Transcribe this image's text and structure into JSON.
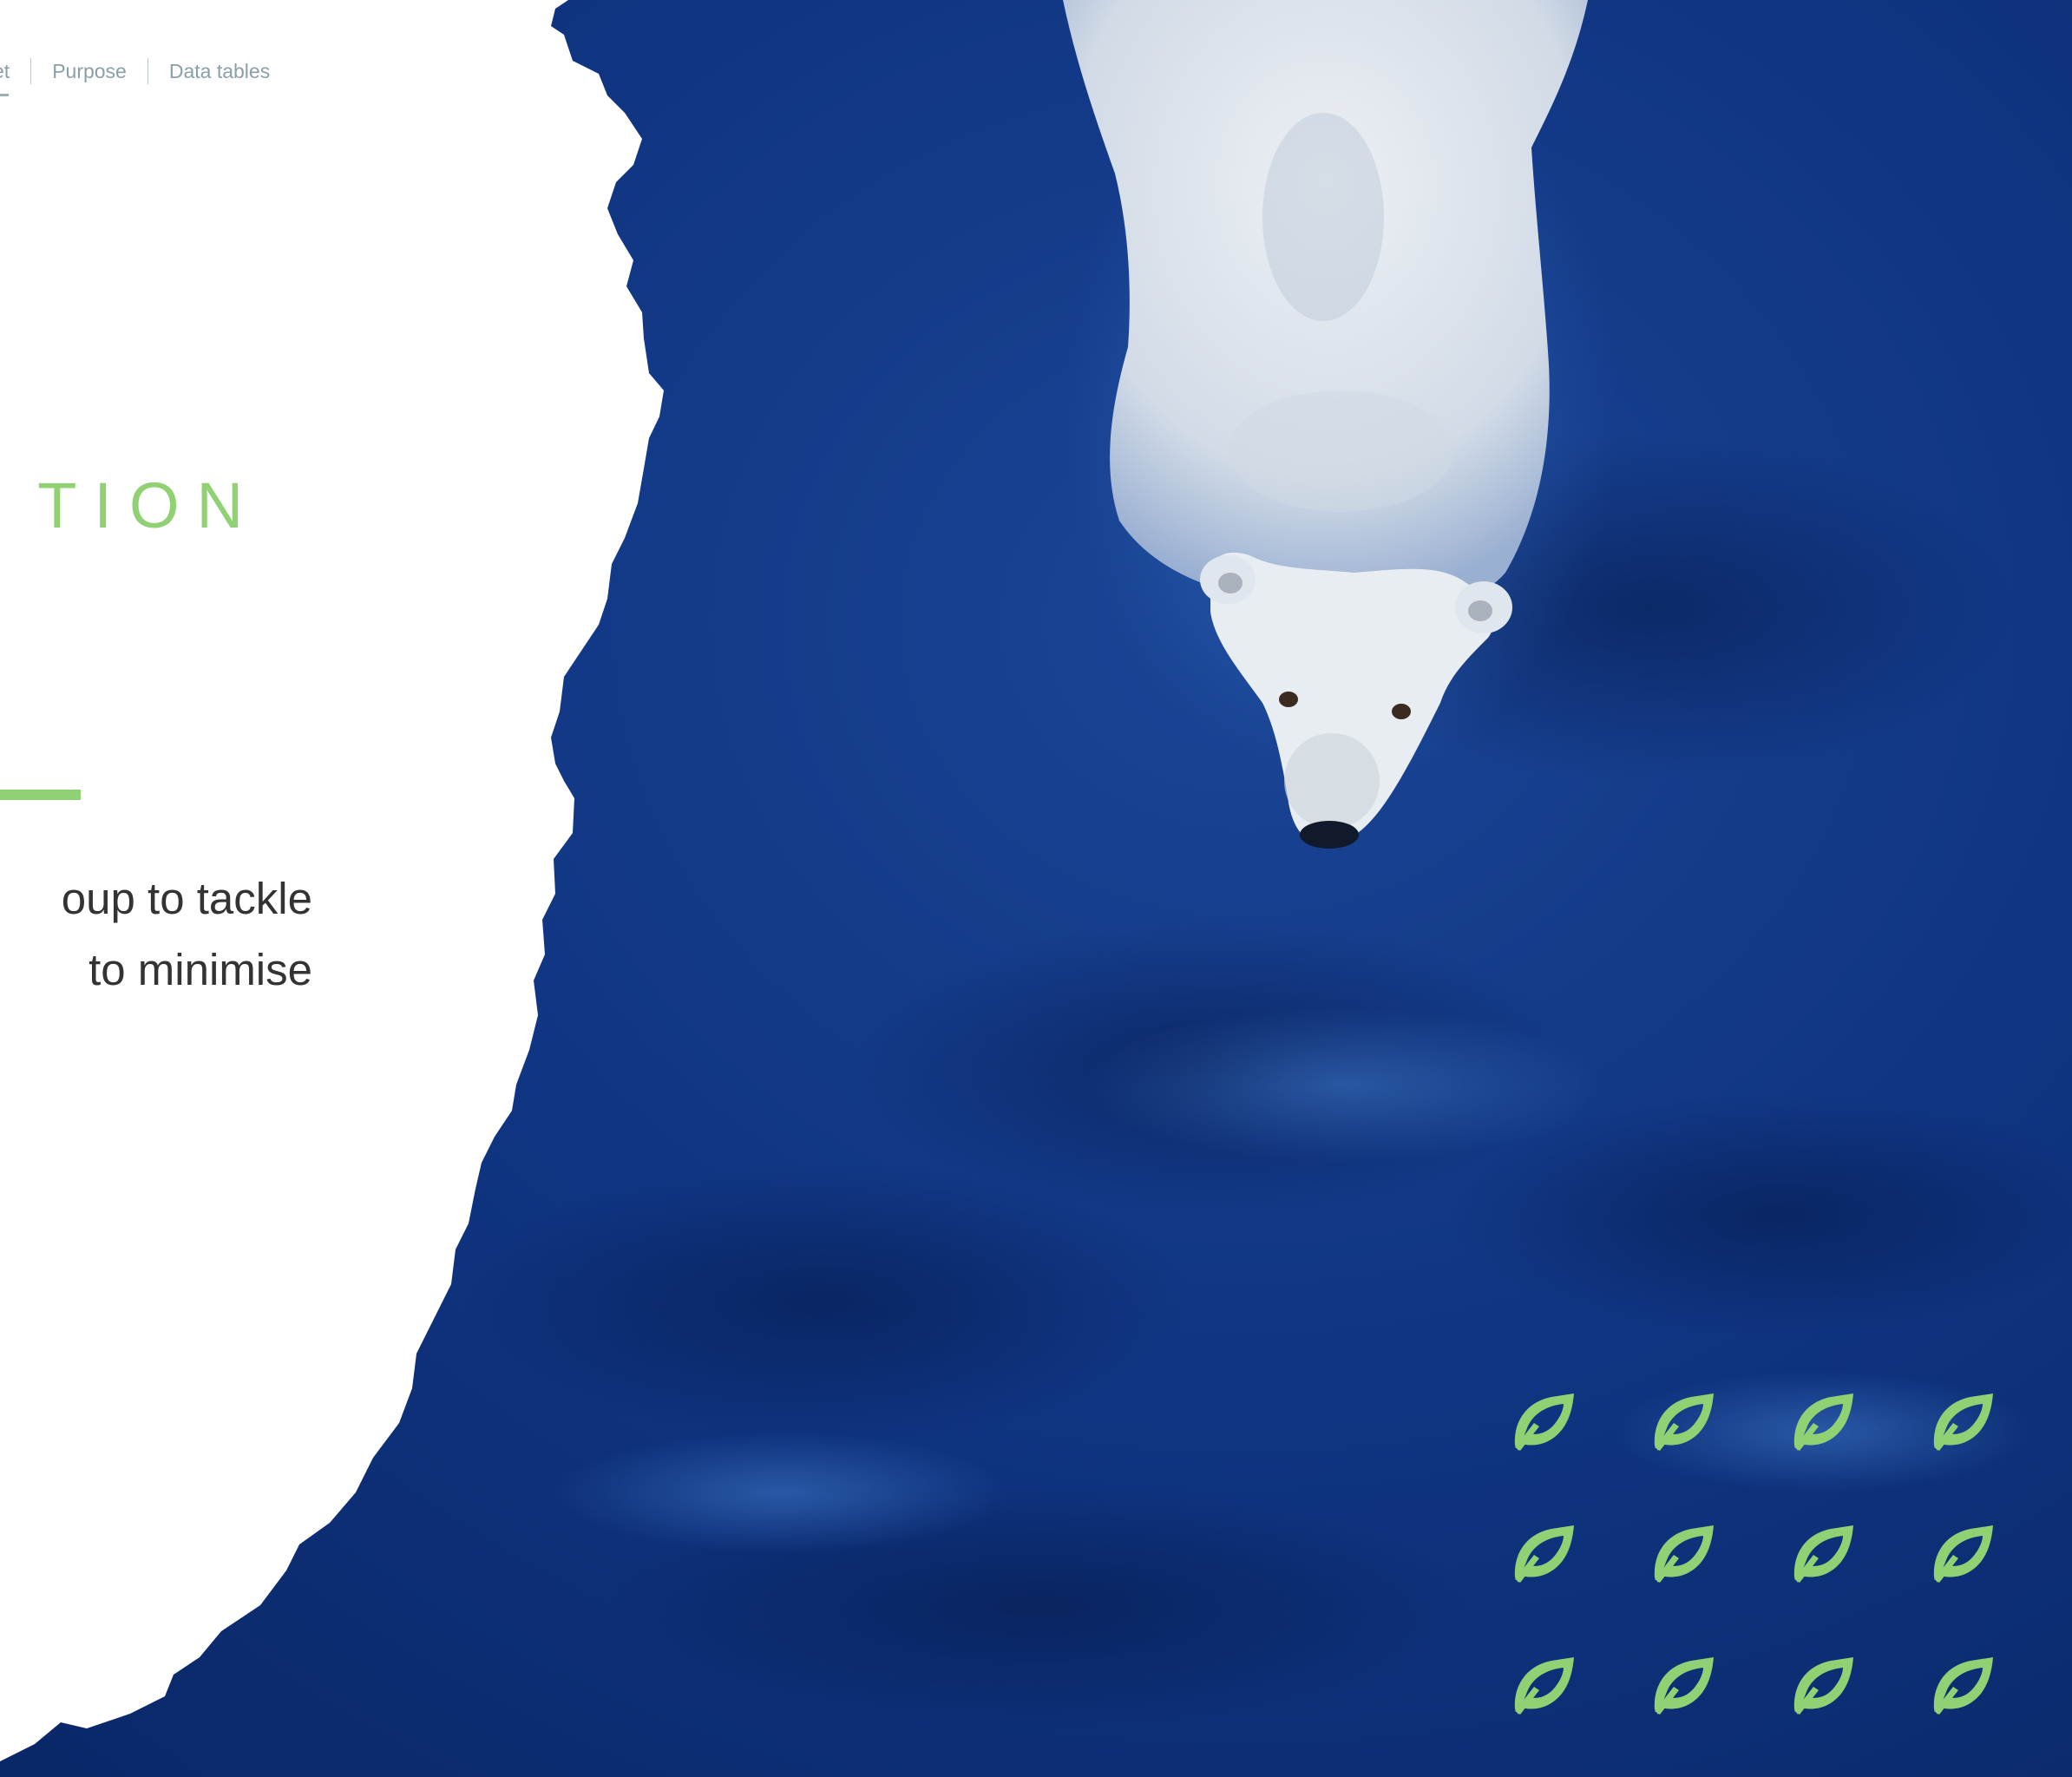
{
  "nav": {
    "items": [
      "et",
      "Purpose",
      "Data tables"
    ]
  },
  "section": {
    "title": "TION"
  },
  "body": {
    "lines": [
      "oup to tackle",
      "to minimise"
    ]
  },
  "photo": {
    "subject": "polar bear swimming in deep blue water"
  },
  "icons": {
    "leaf_icon_name": "leaf-icon",
    "leaf_color": "#8fd173",
    "rows": 3,
    "cols": 4
  },
  "colors": {
    "accent": "#8fd173",
    "ocean_dark": "#0b2a6e",
    "ocean_light": "#1a4b9e",
    "nav_text": "#8aa0a8",
    "body_text": "#333333"
  }
}
